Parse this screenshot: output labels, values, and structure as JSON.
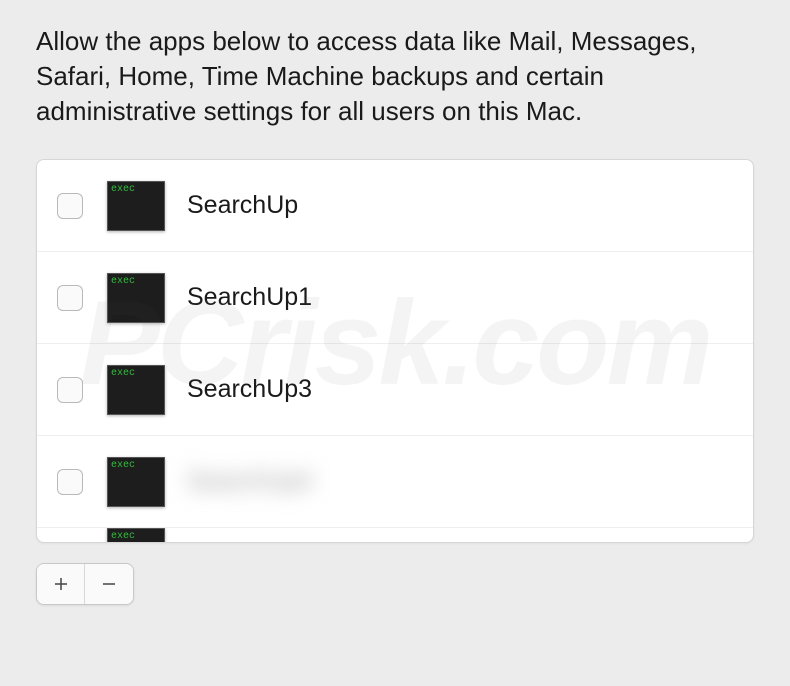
{
  "description": "Allow the apps below to access data like Mail, Messages, Safari, Home, Time Machine backups and certain administrative settings for all users on this Mac.",
  "apps": [
    {
      "name": "SearchUp",
      "checked": false,
      "icon_type": "exec",
      "obscured": false
    },
    {
      "name": "SearchUp1",
      "checked": false,
      "icon_type": "exec",
      "obscured": false
    },
    {
      "name": "SearchUp3",
      "checked": false,
      "icon_type": "exec",
      "obscured": false
    },
    {
      "name": "SearchUp4",
      "checked": false,
      "icon_type": "exec",
      "obscured": true
    }
  ],
  "partial_visible_app": {
    "icon_type": "exec"
  },
  "icon_labels": {
    "exec": "exec"
  },
  "buttons": {
    "add": "+",
    "remove": "−"
  },
  "watermark": "PCrisk.com"
}
